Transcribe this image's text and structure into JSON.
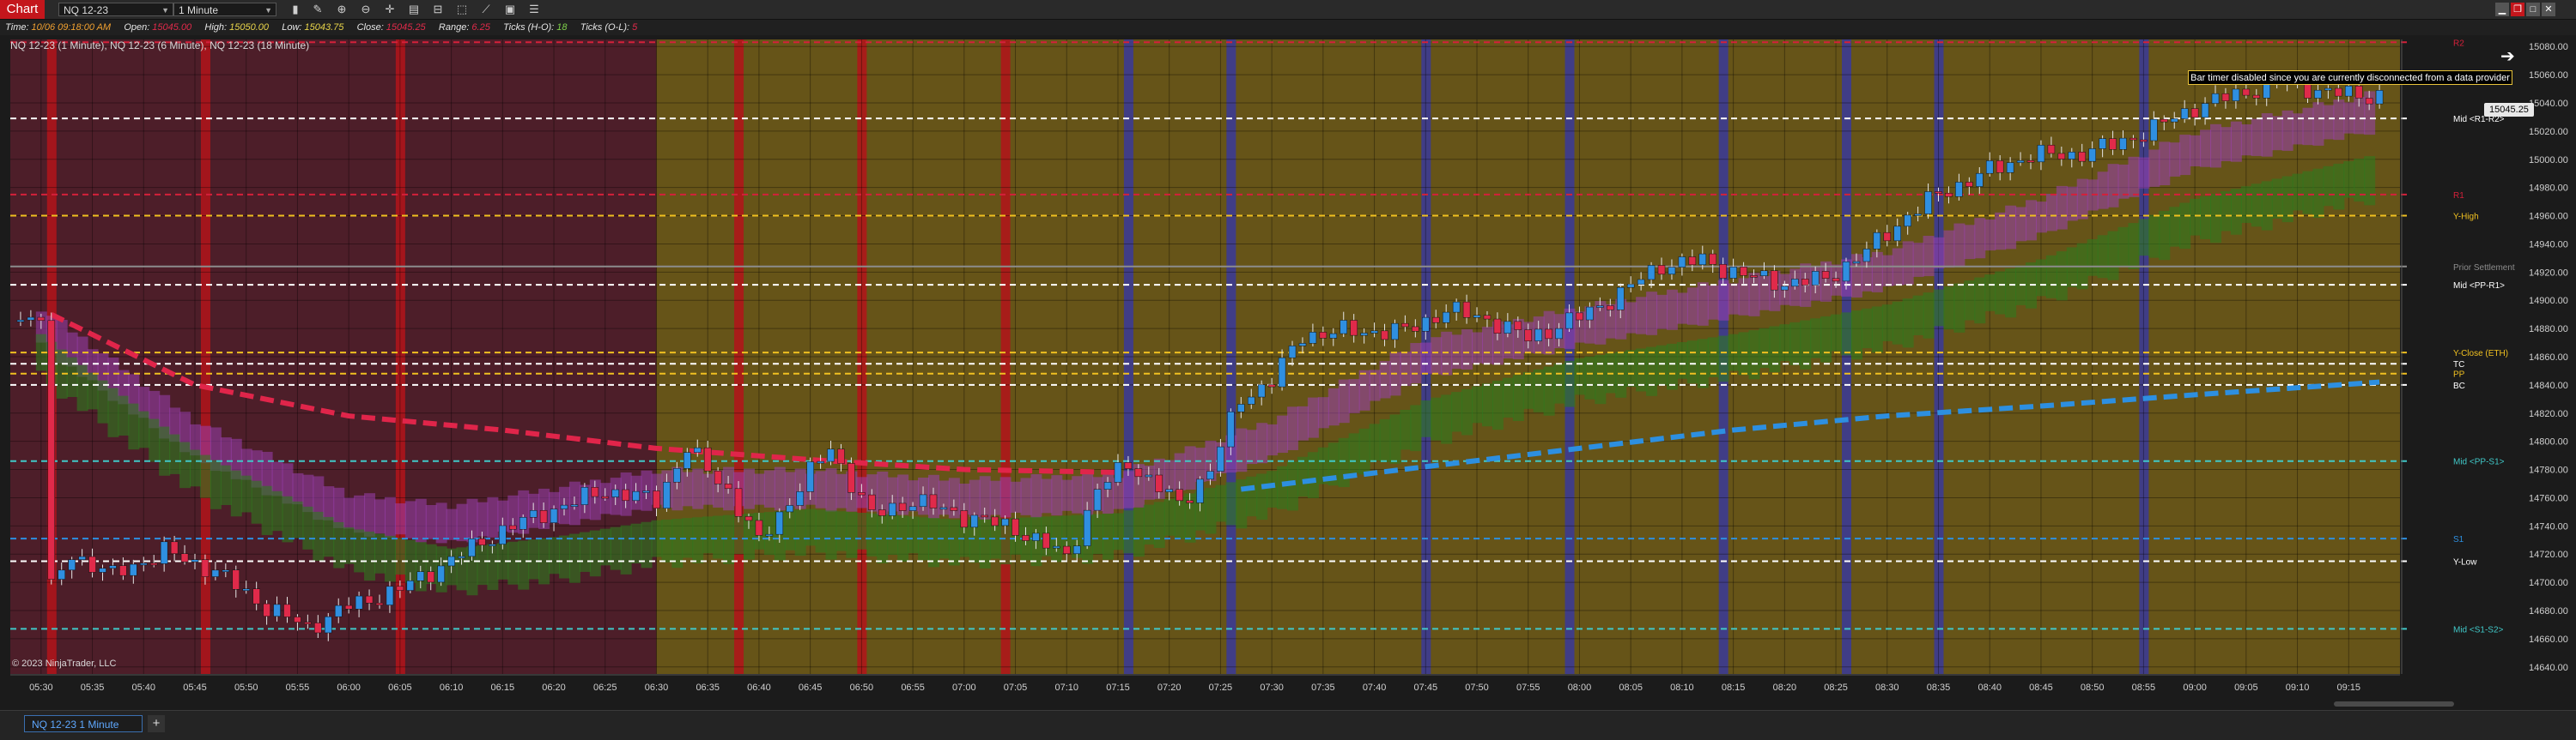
{
  "window": {
    "title": "Chart",
    "instrument": "NQ 12-23",
    "interval": "1 Minute",
    "buttons": [
      "minimize",
      "restore",
      "maximize",
      "close"
    ]
  },
  "toolbar": {
    "icons": [
      "bar-type-icon",
      "pencil-icon",
      "zoom-in-icon",
      "zoom-out-icon",
      "crosshair-icon",
      "properties-icon",
      "templates-icon",
      "strategies-icon",
      "drawing-tools-icon",
      "snapshot-icon",
      "list-icon"
    ]
  },
  "databox": {
    "time_label": "Time:",
    "time_value": "10/06 09:18:00 AM",
    "open_label": "Open:",
    "open_value": "15045.00",
    "high_label": "High:",
    "high_value": "15050.00",
    "low_label": "Low:",
    "low_value": "15043.75",
    "close_label": "Close:",
    "close_value": "15045.25",
    "range_label": "Range:",
    "range_value": "6.25",
    "ticks_ho_label": "Ticks (H-O):",
    "ticks_ho_value": "18",
    "ticks_ol_label": "Ticks (O-L):",
    "ticks_ol_value": "5"
  },
  "chart": {
    "instrument_label": "NQ 12-23 (1 Minute), NQ 12-23 (6 Minute), NQ 12-23 (18 Minute)",
    "copyright": "© 2023 NinjaTrader, LLC",
    "bar_timer_message": "Bar timer disabled since you are currently disconnected from a data provider",
    "last_price": "15045.25",
    "colors": {
      "background": "#1b1b1b",
      "premarket_zone": "#4d1e29",
      "session_zone": "#665418",
      "bull_candle": "#2f8fe0",
      "bear_candle": "#e02a4a",
      "cloud_upper": "#9b3fb0",
      "cloud_lower": "#2f7a1e",
      "red_line": "#e0254a",
      "blue_line": "#2d8fe0",
      "accent_red_bar": "#b3141a",
      "blue_bar": "#3a3a9a"
    }
  },
  "chart_data": {
    "type": "candlestick",
    "y_axis_ticks": [
      "15080.00",
      "15060.00",
      "15040.00",
      "15020.00",
      "15000.00",
      "14980.00",
      "14960.00",
      "14940.00",
      "14920.00",
      "14900.00",
      "14880.00",
      "14860.00",
      "14840.00",
      "14820.00",
      "14800.00",
      "14780.00",
      "14760.00",
      "14740.00",
      "14720.00",
      "14700.00",
      "14680.00",
      "14660.00",
      "14640.00"
    ],
    "x_axis_ticks": [
      "05:30",
      "05:35",
      "05:40",
      "05:45",
      "05:50",
      "05:55",
      "06:00",
      "06:05",
      "06:10",
      "06:15",
      "06:20",
      "06:25",
      "06:30",
      "06:35",
      "06:40",
      "06:45",
      "06:50",
      "06:55",
      "07:00",
      "07:05",
      "07:10",
      "07:15",
      "07:20",
      "07:25",
      "07:30",
      "07:35",
      "07:40",
      "07:45",
      "07:50",
      "07:55",
      "08:00",
      "08:05",
      "08:10",
      "08:15",
      "08:20",
      "08:25",
      "08:30",
      "08:35",
      "08:40",
      "08:45",
      "08:50",
      "08:55",
      "09:00",
      "09:05",
      "09:10",
      "09:15"
    ],
    "ylim": [
      14635,
      15085
    ],
    "time_range": [
      "05:27",
      "09:20"
    ],
    "levels": [
      {
        "label": "R2",
        "price": 15083,
        "color": "#d4203a",
        "style": "dash"
      },
      {
        "label": "Mid <R1-R2>",
        "price": 15029,
        "color": "#ffffff",
        "style": "dash"
      },
      {
        "label": "R1",
        "price": 14975,
        "color": "#d4203a",
        "style": "dash"
      },
      {
        "label": "Y-High",
        "price": 14960,
        "color": "#f0c020",
        "style": "dash"
      },
      {
        "label": "Prior Settlement",
        "price": 14924,
        "color": "#8c8c8c",
        "style": "solid"
      },
      {
        "label": "Mid <PP-R1>",
        "price": 14911,
        "color": "#ffffff",
        "style": "dash"
      },
      {
        "label": "Y-Close (ETH)",
        "price": 14863,
        "color": "#f0c020",
        "style": "dash"
      },
      {
        "label": "TC",
        "price": 14855,
        "color": "#ffffff",
        "style": "dash"
      },
      {
        "label": "PP",
        "price": 14848,
        "color": "#f0c020",
        "style": "dash"
      },
      {
        "label": "BC",
        "price": 14840,
        "color": "#ffffff",
        "style": "dash"
      },
      {
        "label": "Mid <PP-S1>",
        "price": 14786,
        "color": "#40c8c8",
        "style": "dash"
      },
      {
        "label": "S1",
        "price": 14731,
        "color": "#2d8fe0",
        "style": "dash"
      },
      {
        "label": "Y-Low",
        "price": 14715,
        "color": "#ffffff",
        "style": "dash"
      },
      {
        "label": "Mid <S1-S2>",
        "price": 14667,
        "color": "#40c8c8",
        "style": "dash"
      }
    ],
    "zones": [
      {
        "name": "premarket",
        "start": "05:27",
        "end": "06:30"
      },
      {
        "name": "session",
        "start": "06:30",
        "end": "09:20"
      }
    ],
    "red_vertical_bars": [
      "05:31",
      "05:46",
      "06:05",
      "06:38",
      "06:50",
      "07:04"
    ],
    "blue_vertical_bars": [
      "07:16",
      "07:26",
      "07:45",
      "07:59",
      "08:14",
      "08:26",
      "08:35",
      "08:55"
    ],
    "candle_path": [
      [
        "05:27",
        14885
      ],
      [
        "05:30",
        14890
      ],
      [
        "05:31",
        14695
      ],
      [
        "05:33",
        14720
      ],
      [
        "05:37",
        14705
      ],
      [
        "05:42",
        14722
      ],
      [
        "05:47",
        14708
      ],
      [
        "05:52",
        14682
      ],
      [
        "05:56",
        14668
      ],
      [
        "06:00",
        14683
      ],
      [
        "06:05",
        14695
      ],
      [
        "06:10",
        14716
      ],
      [
        "06:15",
        14737
      ],
      [
        "06:20",
        14752
      ],
      [
        "06:25",
        14765
      ],
      [
        "06:30",
        14758
      ],
      [
        "06:33",
        14795
      ],
      [
        "06:37",
        14765
      ],
      [
        "06:40",
        14728
      ],
      [
        "06:45",
        14778
      ],
      [
        "06:47",
        14795
      ],
      [
        "06:51",
        14747
      ],
      [
        "06:55",
        14758
      ],
      [
        "07:00",
        14747
      ],
      [
        "07:05",
        14738
      ],
      [
        "07:10",
        14718
      ],
      [
        "07:13",
        14765
      ],
      [
        "07:16",
        14785
      ],
      [
        "07:21",
        14755
      ],
      [
        "07:24",
        14780
      ],
      [
        "07:27",
        14830
      ],
      [
        "07:30",
        14843
      ],
      [
        "07:33",
        14875
      ],
      [
        "07:37",
        14878
      ],
      [
        "07:43",
        14878
      ],
      [
        "07:47",
        14893
      ],
      [
        "07:51",
        14887
      ],
      [
        "07:55",
        14873
      ],
      [
        "08:00",
        14888
      ],
      [
        "08:04",
        14905
      ],
      [
        "08:08",
        14925
      ],
      [
        "08:12",
        14928
      ],
      [
        "08:16",
        14918
      ],
      [
        "08:20",
        14912
      ],
      [
        "08:24",
        14915
      ],
      [
        "08:28",
        14935
      ],
      [
        "08:32",
        14960
      ],
      [
        "08:35",
        14975
      ],
      [
        "08:40",
        14992
      ],
      [
        "08:44",
        15003
      ],
      [
        "08:48",
        15003
      ],
      [
        "08:52",
        15010
      ],
      [
        "08:56",
        15022
      ],
      [
        "09:00",
        15037
      ],
      [
        "09:05",
        15048
      ],
      [
        "09:09",
        15055
      ],
      [
        "09:13",
        15047
      ],
      [
        "09:18",
        15045
      ]
    ],
    "red_trend_line": [
      [
        "05:31",
        14890
      ],
      [
        "05:45",
        14840
      ],
      [
        "06:00",
        14818
      ],
      [
        "06:15",
        14808
      ],
      [
        "06:30",
        14795
      ],
      [
        "06:45",
        14787
      ],
      [
        "07:00",
        14780
      ],
      [
        "07:15",
        14778
      ]
    ],
    "blue_trend_line": [
      [
        "07:27",
        14766
      ],
      [
        "07:45",
        14782
      ],
      [
        "08:00",
        14795
      ],
      [
        "08:15",
        14808
      ],
      [
        "08:30",
        14818
      ],
      [
        "08:45",
        14825
      ],
      [
        "09:00",
        14833
      ],
      [
        "09:18",
        14842
      ]
    ],
    "cloud_upper_mid": [
      [
        "05:30",
        14880
      ],
      [
        "05:45",
        14800
      ],
      [
        "06:00",
        14748
      ],
      [
        "06:10",
        14740
      ],
      [
        "06:20",
        14752
      ],
      [
        "06:30",
        14765
      ],
      [
        "06:45",
        14765
      ],
      [
        "07:00",
        14758
      ],
      [
        "07:15",
        14762
      ],
      [
        "07:30",
        14800
      ],
      [
        "07:45",
        14858
      ],
      [
        "08:00",
        14880
      ],
      [
        "08:15",
        14900
      ],
      [
        "08:30",
        14920
      ],
      [
        "08:45",
        14958
      ],
      [
        "09:00",
        15005
      ],
      [
        "09:18",
        15033
      ]
    ],
    "cloud_lower_mid": [
      [
        "05:30",
        14872
      ],
      [
        "05:45",
        14790
      ],
      [
        "06:00",
        14735
      ],
      [
        "06:10",
        14720
      ],
      [
        "06:20",
        14728
      ],
      [
        "06:30",
        14740
      ],
      [
        "06:45",
        14748
      ],
      [
        "07:00",
        14740
      ],
      [
        "07:15",
        14745
      ],
      [
        "07:30",
        14775
      ],
      [
        "07:45",
        14825
      ],
      [
        "08:00",
        14855
      ],
      [
        "08:15",
        14872
      ],
      [
        "08:30",
        14893
      ],
      [
        "08:45",
        14925
      ],
      [
        "09:00",
        14968
      ],
      [
        "09:18",
        15000
      ]
    ]
  },
  "bottom": {
    "tab_label": "NQ 12-23 1 Minute",
    "add_tab": "+"
  }
}
